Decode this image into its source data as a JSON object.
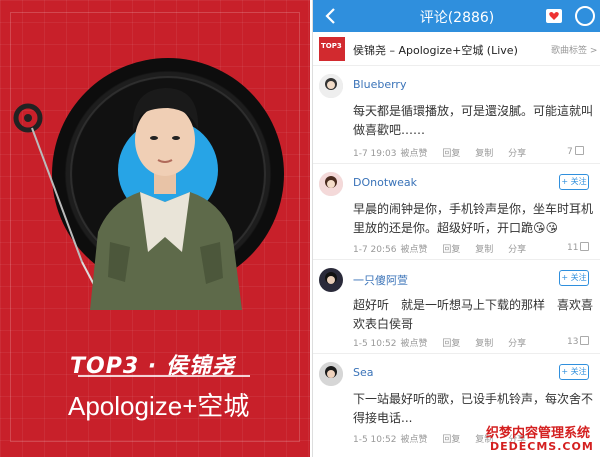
{
  "album_art": {
    "rank_title": "TOP3 · 侯锦尧",
    "song_title": "Apologize+空城",
    "colors": {
      "background": "#c8202a",
      "disc_label": "#27a4e6",
      "record": "#111111"
    }
  },
  "header": {
    "back_icon": "chevron-left-icon",
    "title": "评论(2886)",
    "icons": [
      "heart-icon",
      "disc-icon"
    ],
    "accent": "#2f8fdd"
  },
  "song": {
    "thumb_text": "TOP3",
    "name": "侯锦尧 – Apologize+空城 (Live)",
    "tag_button": "歌曲标签 >"
  },
  "comments": [
    {
      "user": "Blueberry",
      "text": "每天都是循環播放，可是還沒膩。可能這就叫做喜歡吧……",
      "time": "1-7 19:03",
      "replied": "被点赞",
      "reply": "回复",
      "copy": "复制",
      "share": "分享",
      "likes": "7",
      "follow": null
    },
    {
      "user": "DOnotweak",
      "text": "早晨的闹钟是你，手机铃声是你，坐车时耳机里放的还是你。超级好听，开口跪😘😘",
      "time": "1-7 20:56",
      "replied": "被点赞",
      "reply": "回复",
      "copy": "复制",
      "share": "分享",
      "likes": "11",
      "follow": "+ 关注"
    },
    {
      "user": "一只傻阿萱",
      "text": "超好听　就是一听想马上下载的那样　喜欢喜欢表白侯哥",
      "time": "1-5 10:52",
      "replied": "被点赞",
      "reply": "回复",
      "copy": "复制",
      "share": "分享",
      "likes": "13",
      "follow": "+ 关注"
    },
    {
      "user": "Sea",
      "text": "下一站最好听的歌，已设手机铃声，每次舍不得接电话...",
      "time": "1-5 10:52",
      "replied": "被点赞",
      "reply": "回复",
      "copy": "复制",
      "share": "分享",
      "likes": "",
      "follow": "+ 关注"
    }
  ],
  "watermark": {
    "line1": "织梦内容管理系统",
    "line2": "DEDECMS.COM"
  }
}
